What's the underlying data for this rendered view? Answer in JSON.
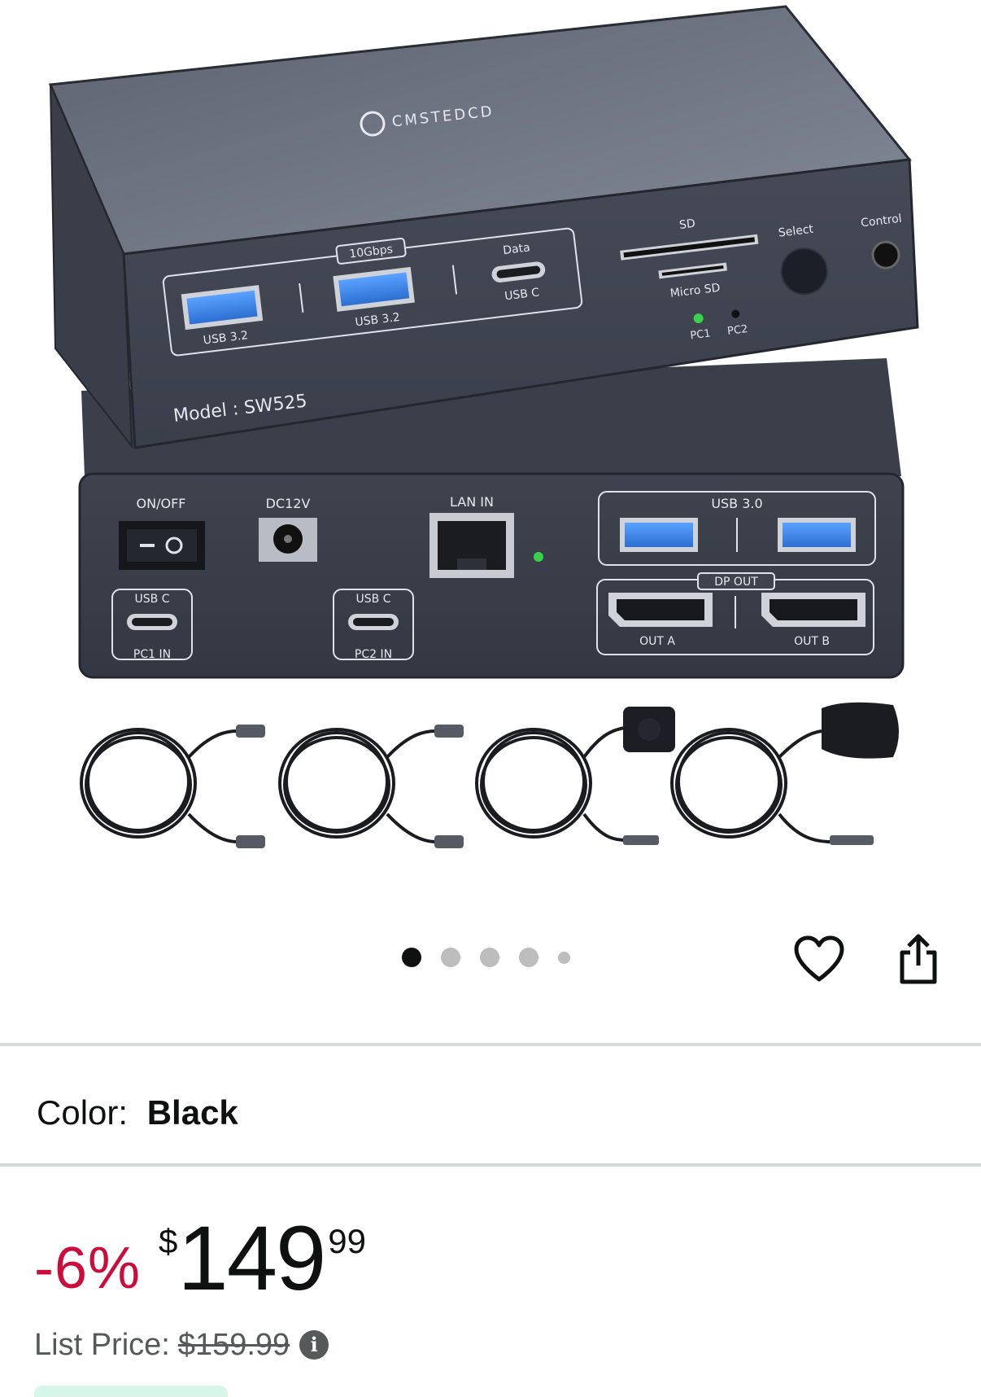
{
  "product_image": {
    "alt": "",
    "device_labels": {
      "brand": "CMSTEDCD",
      "model": "Model : SW525",
      "speed": "10Gbps",
      "usb32_left": "USB 3.2",
      "usb32_mid": "USB 3.2",
      "data": "Data",
      "usbc_front": "USB C",
      "sd": "SD",
      "micro_sd": "Micro SD",
      "select": "Select",
      "control": "Control",
      "pc1": "PC1",
      "pc2": "PC2",
      "on_off": "ON/OFF",
      "dc12v": "DC12V",
      "lan_in": "LAN IN",
      "usb30": "USB 3.0",
      "dp_out": "DP OUT",
      "out_a": "OUT A",
      "out_b": "OUT B",
      "usbc_back1": "USB C",
      "usbc_back2": "USB C",
      "pc1_in": "PC1 IN",
      "pc2_in": "PC2 IN"
    }
  },
  "carousel": {
    "count": 5,
    "active_index": 0
  },
  "actions": {
    "favorite_icon": "heart-icon",
    "share_icon": "share-icon"
  },
  "color": {
    "label": "Color:",
    "value": "Black"
  },
  "price": {
    "discount": "-6%",
    "symbol": "$",
    "whole": "149",
    "fraction": "99",
    "list_label": "List Price:",
    "list_value": "$159.99",
    "info_icon": "i"
  },
  "colors": {
    "discount": "#cc0c39",
    "text": "#0f1111",
    "muted": "#565959",
    "divider": "#d5d9d9",
    "badge": "#d7f5e9"
  }
}
